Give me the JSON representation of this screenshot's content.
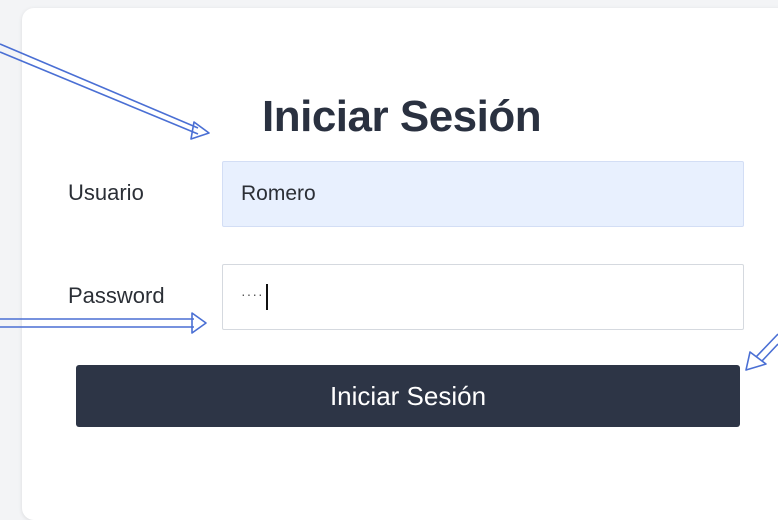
{
  "login": {
    "title": "Iniciar Sesión",
    "username_label": "Usuario",
    "username_value": "Romero",
    "password_label": "Password",
    "password_masked": "····",
    "submit_label": "Iniciar Sesión"
  },
  "colors": {
    "button_bg": "#2d3546",
    "autofill_bg": "#e8f0fe",
    "annotation_arrow": "#4a6fd4"
  },
  "annotations": {
    "arrow_count": 3,
    "icon": "double-line-arrow-icon"
  }
}
